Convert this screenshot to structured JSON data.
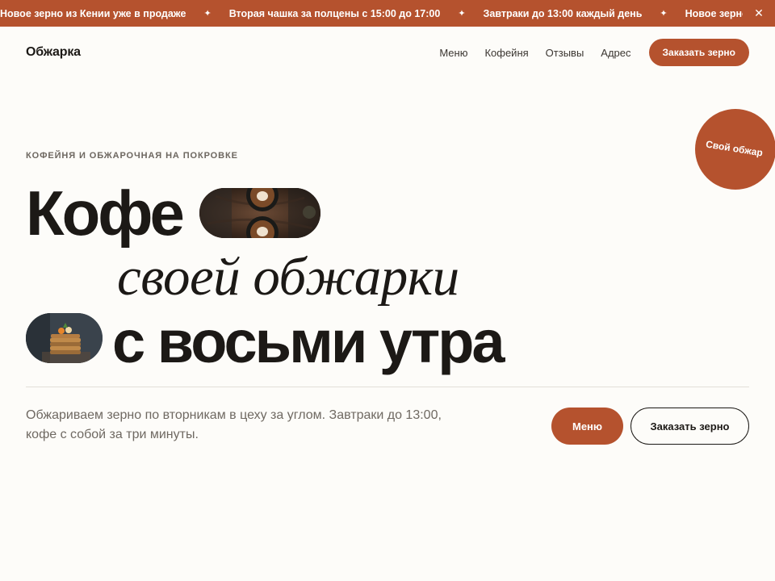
{
  "ticker": {
    "items": [
      "Новое зерно из Кении уже в продаже",
      "Вторая чашка за полцены с 15:00 до 17:00",
      "Завтраки до 13:00 каждый день",
      "Новое зерно из Кении уже в продаже"
    ],
    "separator": "✦",
    "close_label": "✕"
  },
  "header": {
    "logo": "Обжарка",
    "nav": [
      "Меню",
      "Кофейня",
      "Отзывы",
      "Адрес"
    ],
    "cta": "Заказать зерно"
  },
  "badge": {
    "label": "Свой обжар"
  },
  "hero": {
    "eyebrow": "КОФЕЙНЯ И ОБЖАРОЧНАЯ НА ПОКРОВКЕ",
    "line1": "Кофе",
    "line2": "своей обжарки",
    "line3": "с восьми утра",
    "intro": "Обжариваем зерно по вторникам в цеху за углом. Завтраки до 13:00, кофе с собой за три минуты.",
    "menu_button": "Меню",
    "order_button": "Заказать зерно"
  },
  "colors": {
    "accent": "#b5522e",
    "background": "#fdfcf9",
    "text": "#1c1916",
    "muted": "#6f6962"
  }
}
